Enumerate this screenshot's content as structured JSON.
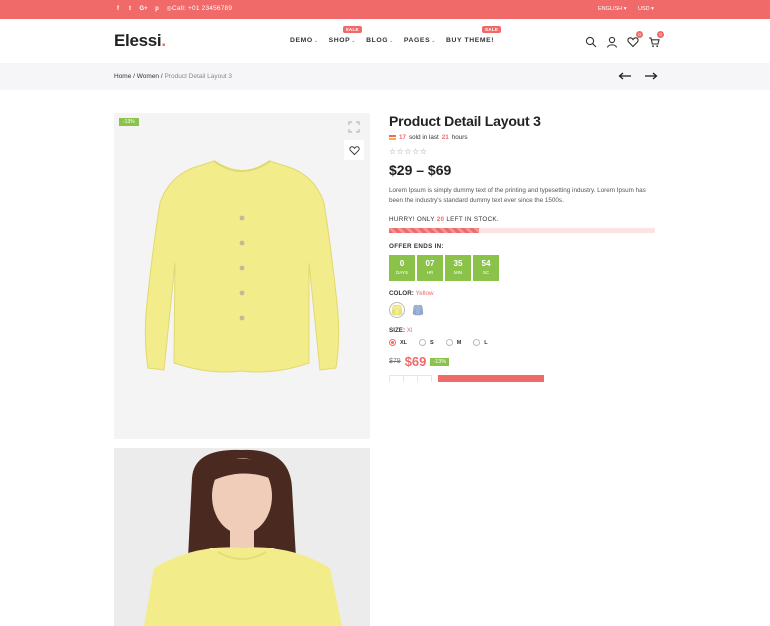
{
  "topbar": {
    "social": [
      {
        "icon": "facebook-icon",
        "glyph": "f"
      },
      {
        "icon": "twitter-icon",
        "glyph": "t"
      },
      {
        "icon": "google-plus-icon",
        "glyph": "G+"
      },
      {
        "icon": "pinterest-icon",
        "glyph": "p"
      },
      {
        "icon": "instagram-icon",
        "glyph": "◎"
      }
    ],
    "call": "Call:  +01 23456789",
    "language": "ENGLISH",
    "currency": "USD"
  },
  "header": {
    "logo": "Elessi",
    "logo_dot": ".",
    "nav": [
      {
        "label": "DEMO",
        "badge": ""
      },
      {
        "label": "SHOP",
        "badge": "SALE"
      },
      {
        "label": "BLOG",
        "badge": ""
      },
      {
        "label": "PAGES",
        "badge": ""
      },
      {
        "label": "BUY THEME!",
        "badge": "SALE"
      }
    ],
    "wishlist_count": "0",
    "cart_count": "0"
  },
  "breadcrumb": {
    "home": "Home",
    "sep1": " / ",
    "category": "Women",
    "sep2": " / ",
    "current": "Product Detail Layout 3"
  },
  "gallery": {
    "discount_tag": "-13%"
  },
  "product": {
    "title": "Product Detail Layout 3",
    "sold_count": "17",
    "sold_mid": "sold in last",
    "sold_hours": "21",
    "sold_suffix": "hours",
    "stars": "☆☆☆☆☆",
    "price_range": "$29 – $69",
    "description": "Lorem Ipsum is simply dummy text of the printing and typesetting industry. Lorem Ipsum has been the industry's standard dummy text ever since the 1500s.",
    "hurry_prefix": "HURRY! ONLY",
    "hurry_count": "20",
    "hurry_suffix": "LEFT IN STOCK.",
    "stock_fraction": 0.34,
    "offer_label": "OFFER ENDS IN:",
    "countdown": [
      {
        "value": "0",
        "unit": "DAYS"
      },
      {
        "value": "07",
        "unit": "HR"
      },
      {
        "value": "35",
        "unit": "MIN"
      },
      {
        "value": "54",
        "unit": "SC"
      }
    ],
    "color_label": "COLOR:",
    "color_value": "Yellow",
    "size_label": "SIZE:",
    "size_value": "Xl",
    "sizes": [
      "XL",
      "S",
      "M",
      "L"
    ],
    "old_price": "$79",
    "new_price": "$69",
    "discount": "-13%"
  },
  "colors": {
    "accent": "#f16a6a",
    "green": "#8bc34a",
    "product_yellow": "#f3ec8a"
  }
}
